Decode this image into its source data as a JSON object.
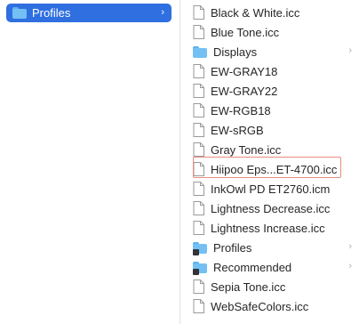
{
  "left_column": {
    "selected_item": {
      "label": "Profiles",
      "icon": "folder-icon"
    }
  },
  "right_column": {
    "items": [
      {
        "label": "Black & White.icc",
        "icon": "document-icon",
        "has_chevron": false
      },
      {
        "label": "Blue Tone.icc",
        "icon": "document-icon",
        "has_chevron": false
      },
      {
        "label": "Displays",
        "icon": "folder-icon",
        "has_chevron": true
      },
      {
        "label": "EW-GRAY18",
        "icon": "document-icon",
        "has_chevron": false
      },
      {
        "label": "EW-GRAY22",
        "icon": "document-icon",
        "has_chevron": false
      },
      {
        "label": "EW-RGB18",
        "icon": "document-icon",
        "has_chevron": false
      },
      {
        "label": "EW-sRGB",
        "icon": "document-icon",
        "has_chevron": false
      },
      {
        "label": "Gray Tone.icc",
        "icon": "document-icon",
        "has_chevron": false
      },
      {
        "label": "Hiipoo Eps...ET-4700.icc",
        "icon": "document-icon",
        "has_chevron": false,
        "highlighted": true
      },
      {
        "label": "InkOwl PD ET2760.icm",
        "icon": "document-icon",
        "has_chevron": false
      },
      {
        "label": "Lightness Decrease.icc",
        "icon": "document-icon",
        "has_chevron": false
      },
      {
        "label": "Lightness Increase.icc",
        "icon": "document-icon",
        "has_chevron": false
      },
      {
        "label": "Profiles",
        "icon": "alias-folder-icon",
        "has_chevron": true
      },
      {
        "label": "Recommended",
        "icon": "alias-folder-icon",
        "has_chevron": true
      },
      {
        "label": "Sepia Tone.icc",
        "icon": "document-icon",
        "has_chevron": false
      },
      {
        "label": "WebSafeColors.icc",
        "icon": "document-icon",
        "has_chevron": false
      }
    ]
  },
  "colors": {
    "selection": "#2f6fe0",
    "highlight_border": "#e88d80",
    "folder": "#74c0f4"
  },
  "chevron_glyph": "›"
}
